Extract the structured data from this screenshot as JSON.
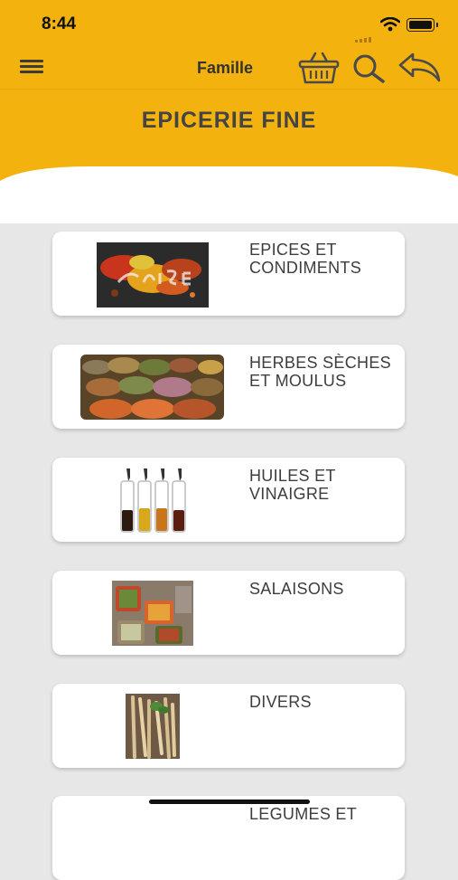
{
  "status": {
    "time": "8:44"
  },
  "toolbar": {
    "title": "Famille",
    "icons": [
      "menu-icon",
      "basket-icon",
      "search-icon",
      "back-icon"
    ]
  },
  "page": {
    "title": "EPICERIE FINE"
  },
  "colors": {
    "accent": "#f4b20f",
    "text": "#3d3d3d",
    "background": "#e7e7e7"
  },
  "categories": [
    {
      "label": "EPICES ET CONDIMENTS",
      "image": "spices-photo"
    },
    {
      "label": "HERBES SÈCHES ET MOULUS",
      "image": "herbs-market-photo"
    },
    {
      "label": "HUILES ET VINAIGRE",
      "image": "oil-bottles-photo"
    },
    {
      "label": "SALAISONS",
      "image": "pickle-jars-photo"
    },
    {
      "label": "DIVERS",
      "image": "breadsticks-photo"
    },
    {
      "label": "LEGUMES ET",
      "image": ""
    }
  ]
}
